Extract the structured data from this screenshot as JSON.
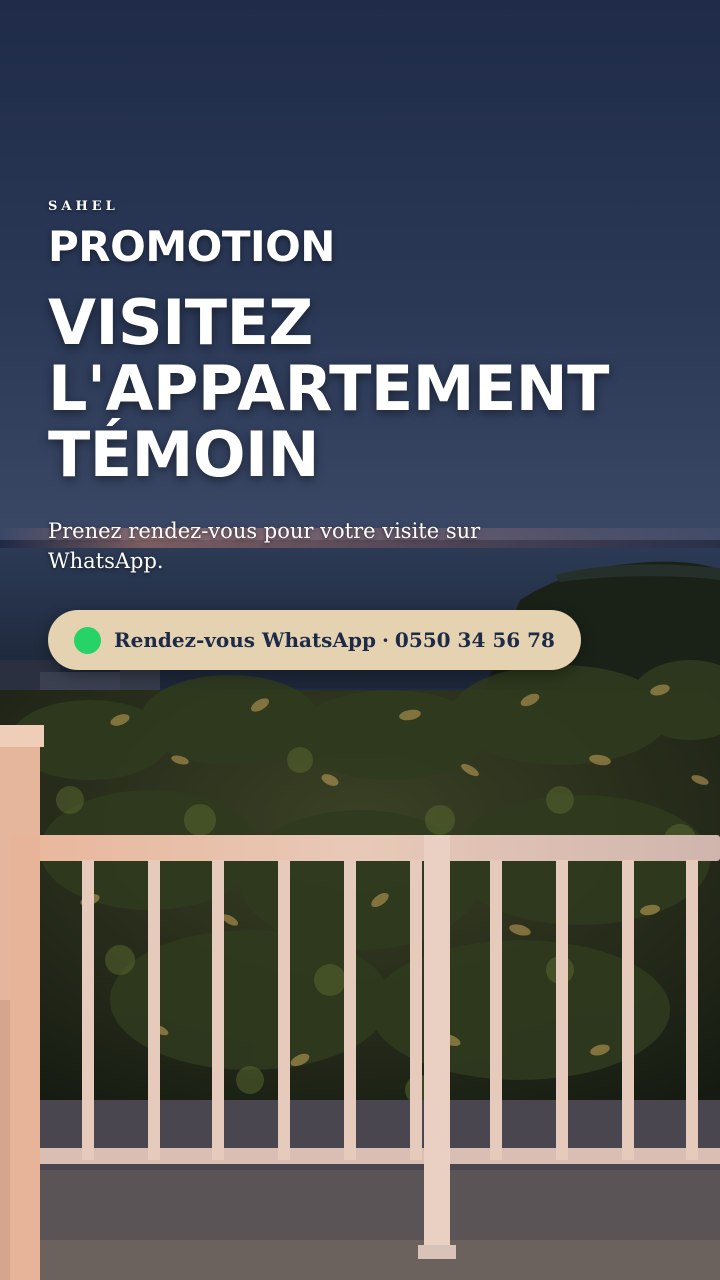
{
  "brand": "SAHEL",
  "promo": "PROMOTION",
  "headline": [
    "VISITEZ",
    "L'APPARTEMENT",
    "TÉMOIN"
  ],
  "subtitle": "Prenez rendez-vous pour votre visite sur WhatsApp.",
  "cta": {
    "label": "Rendez-vous WhatsApp",
    "separator": "·",
    "phone": "0550 34 56 78",
    "icon": "whatsapp-dot-icon",
    "icon_color": "#25d366"
  },
  "colors": {
    "cta_background": "#e4d2b0",
    "cta_text": "#1d2a48",
    "sky": "#1e2a45"
  }
}
